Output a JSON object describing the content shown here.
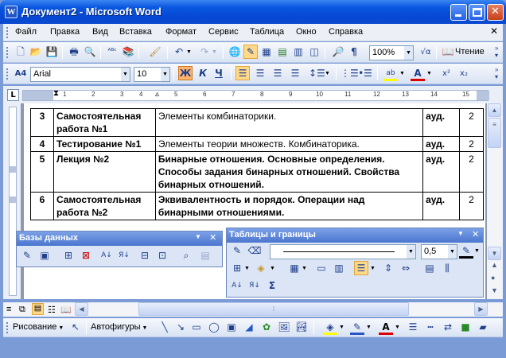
{
  "window": {
    "title": "Документ2 - Microsoft Word",
    "app_icon": "W"
  },
  "menu": [
    "Файл",
    "Правка",
    "Вид",
    "Вставка",
    "Формат",
    "Сервис",
    "Таблица",
    "Окно",
    "Справка"
  ],
  "standard_toolbar": {
    "zoom": "100%",
    "read_label": "Чтение"
  },
  "formatting_toolbar": {
    "style_icon": "А4",
    "font": "Arial",
    "size": "10",
    "bold": "Ж",
    "italic": "К",
    "underline": "Ч"
  },
  "ruler": {
    "tab_selector": "L",
    "numbers": [
      "1",
      "2",
      "3",
      "4",
      "5",
      "6",
      "7",
      "8",
      "9",
      "10",
      "11",
      "12",
      "13",
      "14",
      "15"
    ]
  },
  "table": {
    "rows": [
      {
        "num": "3",
        "type": "Самостоятельная работа №1",
        "topic": "Элементы комбинаторики.",
        "topic_bold": false,
        "aud": "ауд.",
        "hours": "2"
      },
      {
        "num": "4",
        "type": "Тестирование №1",
        "topic": "Элементы теории множеств. Комбинаторика.",
        "topic_bold": false,
        "aud": "ауд.",
        "hours": "2"
      },
      {
        "num": "5",
        "type": "Лекция №2",
        "topic": "Бинарные отношения. Основные определения. Способы задания бинарных отношений. Свойства бинарных отношений.",
        "topic_bold": true,
        "aud": "ауд.",
        "hours": "2"
      },
      {
        "num": "6",
        "type": "Самостоятельная работа №2",
        "topic": "Эквивалентность и порядок. Операции над бинарными отношениями.",
        "topic_bold": true,
        "aud": "ауд.",
        "hours": "2"
      }
    ]
  },
  "db_toolbar": {
    "title": "Базы данных"
  },
  "tables_toolbar": {
    "title": "Таблицы и границы",
    "line_weight": "0,5",
    "sum": "Σ"
  },
  "draw_toolbar": {
    "draw_label": "Рисование",
    "autoshapes_label": "Автофигуры"
  }
}
